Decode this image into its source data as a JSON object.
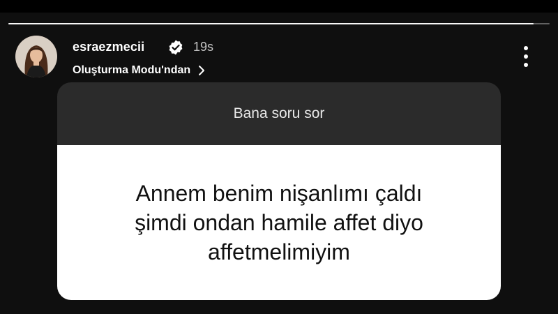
{
  "story": {
    "progress": 0.97,
    "username": "esraezmecii",
    "verified": true,
    "timestamp": "19s",
    "subtitle": "Oluşturma Modu'ndan",
    "icons": {
      "verified": "verified-badge-icon",
      "chevron": "chevron-right-icon",
      "more": "more-vertical-icon"
    }
  },
  "question_card": {
    "prompt": "Bana soru sor",
    "answer": "Annem benim nişanlımı çaldı\nşimdi ondan hamile affet diyo\naffetmelimiyim"
  },
  "colors": {
    "background": "#0f0f0f",
    "card_header": "#2b2b2b",
    "card_body": "#ffffff",
    "accent": "#ffffff"
  }
}
